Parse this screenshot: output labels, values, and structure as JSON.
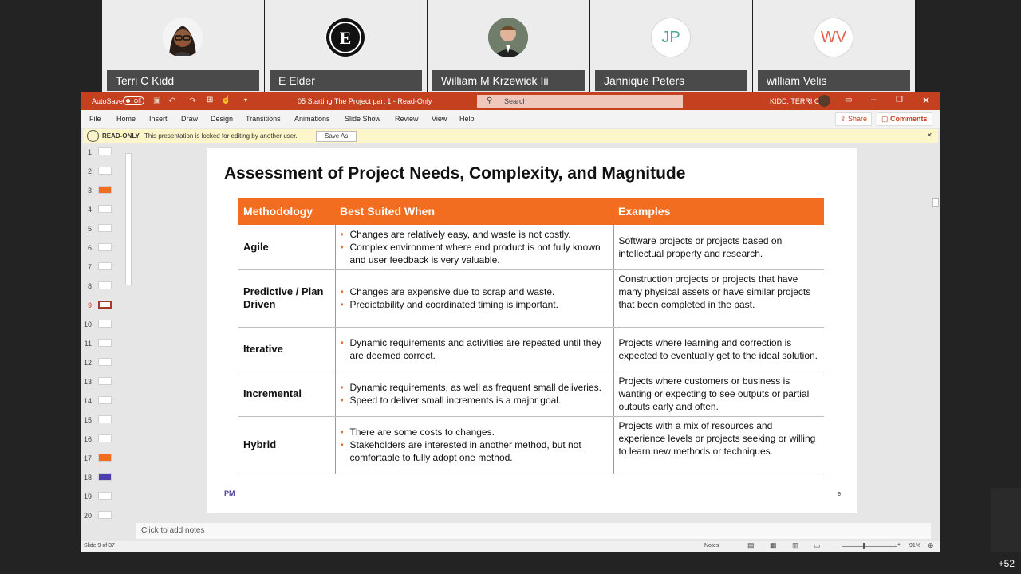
{
  "participants": [
    {
      "name": "Terri C Kidd",
      "avatar": "cartoon-portrait"
    },
    {
      "name": "E Elder",
      "avatar": "E"
    },
    {
      "name": "William M Krzewick Iii",
      "avatar": "photo"
    },
    {
      "name": "Jannique Peters",
      "initials": "JP",
      "color": "#4aa896"
    },
    {
      "name": "william Velis",
      "initials": "WV",
      "color": "#e0604c"
    }
  ],
  "ppt": {
    "autosave": "AutoSave",
    "autosave_state": "Off",
    "title": "05 Starting The Project part 1  -  Read-Only",
    "search_placeholder": "Search",
    "user": "KIDD, TERRI C",
    "menu": [
      "File",
      "Home",
      "Insert",
      "Draw",
      "Design",
      "Transitions",
      "Animations",
      "Slide Show",
      "Review",
      "View",
      "Help"
    ],
    "share": "Share",
    "comments": "Comments",
    "msg_label": "READ-ONLY",
    "msg_text": "This presentation is locked for editing by another user.",
    "save_as": "Save As",
    "notes_placeholder": "Click to add notes",
    "status_left": "Slide 9 of 37",
    "notes_btn": "Notes",
    "zoom": "91%"
  },
  "slides": [
    "1",
    "2",
    "3",
    "4",
    "5",
    "6",
    "7",
    "8",
    "9",
    "10",
    "11",
    "12",
    "13",
    "14",
    "15",
    "16",
    "17",
    "18",
    "19",
    "20"
  ],
  "slide": {
    "title": "Assessment of Project Needs, Complexity, and Magnitude",
    "headers": [
      "Methodology",
      "Best Suited When",
      "Examples"
    ],
    "rows": [
      {
        "m": "Agile",
        "b": [
          "Changes are relatively easy, and waste is not costly.",
          "Complex environment where end product is not fully known and user feedback is very valuable."
        ],
        "e": "Software projects or projects based on intellectual property and research."
      },
      {
        "m": "Predictive / Plan Driven",
        "b": [
          "Changes are expensive due to scrap and waste.",
          "Predictability and coordinated timing is important."
        ],
        "e": "Construction projects or projects that have many physical assets or have similar projects that been completed in the past."
      },
      {
        "m": "Iterative",
        "b": [
          "Dynamic requirements and activities are repeated until they are deemed correct."
        ],
        "e": "Projects where learning and correction is expected to eventually get to the ideal solution."
      },
      {
        "m": "Incremental",
        "b": [
          "Dynamic requirements, as well as frequent small deliveries.",
          "Speed to deliver small increments is a major goal."
        ],
        "e": "Projects where customers or business is wanting or expecting to see outputs or partial outputs early and often."
      },
      {
        "m": "Hybrid",
        "b": [
          "There are some costs to changes.",
          "Stakeholders are interested in another method, but not comfortable to fully adopt one method."
        ],
        "e": "Projects with a mix of resources and experience levels or projects seeking or willing to learn new methods or techniques."
      }
    ],
    "page": "9",
    "logo": "PM"
  },
  "more_participants": "+52"
}
